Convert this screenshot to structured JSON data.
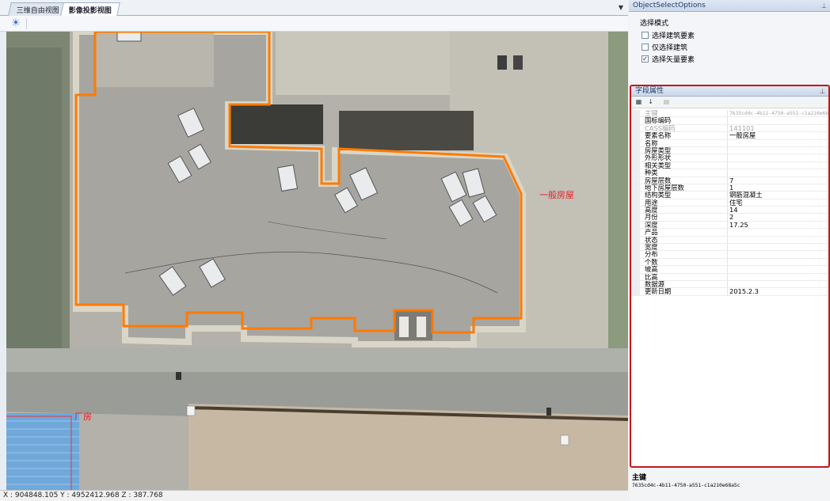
{
  "tabs": [
    {
      "label": "三维自由视图",
      "active": false
    },
    {
      "label": "影像投影视图",
      "active": true
    }
  ],
  "map": {
    "label_general": "一般房屋",
    "label_plant": "厂房",
    "outline_color": "#ff7a00",
    "label_color": "#e8202a",
    "status": "X : 904848.105 Y : 4952412.968 Z : 387.768"
  },
  "options_panel": {
    "title": "ObjectSelectOptions",
    "mode_label": "选择模式",
    "options": [
      {
        "label": "选择建筑要素",
        "checked": false
      },
      {
        "label": "仅选择建筑",
        "checked": false
      },
      {
        "label": "选择矢量要素",
        "checked": true
      }
    ]
  },
  "props_panel": {
    "title": "字段属性",
    "highlight_color": "#c3161c",
    "rows": [
      {
        "name": "主键",
        "value": "7635cd4c-4b11-4750-a551-c1a210e68a5c",
        "dim": true,
        "mono": true
      },
      {
        "name": "国标编码",
        "value": "",
        "dim": false
      },
      {
        "name": "CASS编码",
        "value": "141101",
        "dim": true
      },
      {
        "name": "要素名称",
        "value": "一般房屋",
        "dim": false
      },
      {
        "name": "名称",
        "value": "",
        "dim": false
      },
      {
        "name": "房屋类型",
        "value": "",
        "dim": false
      },
      {
        "name": "外形形状",
        "value": "",
        "dim": false
      },
      {
        "name": "相关类型",
        "value": "",
        "dim": false
      },
      {
        "name": "种类",
        "value": "",
        "dim": false
      },
      {
        "name": "房屋层数",
        "value": "7",
        "dim": false
      },
      {
        "name": "地下房屋层数",
        "value": "1",
        "dim": false
      },
      {
        "name": "结构类型",
        "value": "钢筋混凝土",
        "dim": false
      },
      {
        "name": "用途",
        "value": "住宅",
        "dim": false
      },
      {
        "name": "高度",
        "value": "14",
        "dim": false
      },
      {
        "name": "月份",
        "value": "2",
        "dim": false
      },
      {
        "name": "深度",
        "value": "17.25",
        "dim": false
      },
      {
        "name": "产品",
        "value": "",
        "dim": false
      },
      {
        "name": "状态",
        "value": "",
        "dim": false
      },
      {
        "name": "宽度",
        "value": "",
        "dim": false
      },
      {
        "name": "分布",
        "value": "",
        "dim": false
      },
      {
        "name": "个数",
        "value": "",
        "dim": false
      },
      {
        "name": "坡高",
        "value": "",
        "dim": false
      },
      {
        "name": "比高",
        "value": "",
        "dim": false
      },
      {
        "name": "数据源",
        "value": "",
        "dim": false
      },
      {
        "name": "更新日期",
        "value": "2015.2.3",
        "dim": false
      }
    ]
  },
  "description": {
    "title": "主键",
    "text": "7635cd4c-4b11-4750-a551-c1a210e68a5c"
  },
  "icons": {
    "sun": "sun-icon",
    "pin": "pin-icon",
    "sort_category": "categorized-sort-icon",
    "sort_alpha": "alphabetical-sort-icon",
    "property_pages": "property-pages-icon"
  }
}
